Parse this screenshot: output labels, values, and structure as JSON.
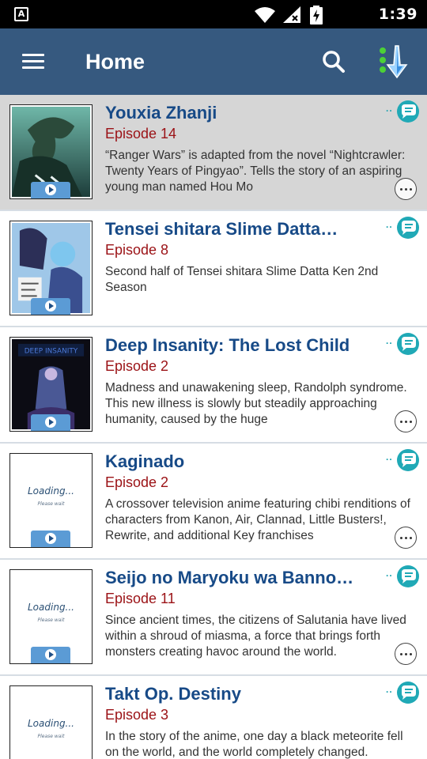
{
  "status_bar": {
    "badge": "A",
    "time": "1:39"
  },
  "app_bar": {
    "title": "Home"
  },
  "items": [
    {
      "title": "Youxia Zhanji",
      "episode": "Episode 14",
      "description": "“Ranger Wars” is adapted from the novel “Nightcrawler: Twenty Years of Pingyao”. Tells the story of an aspiring young man named Hou Mo",
      "thumb": "art-1",
      "loading": false
    },
    {
      "title": "Tensei shitara Slime Datta…",
      "episode": "Episode 8",
      "description": "Second half of Tensei shitara Slime Datta Ken 2nd Season",
      "thumb": "art-2",
      "loading": false
    },
    {
      "title": "Deep Insanity: The Lost Child",
      "episode": "Episode 2",
      "description": "Madness and unawakening sleep, Randolph syndrome. This new illness is slowly but steadily approaching humanity, caused by the huge",
      "thumb": "art-3",
      "loading": false
    },
    {
      "title": "Kaginado",
      "episode": "Episode 2",
      "description": "A crossover television anime featuring chibi renditions of characters from Kanon, Air, Clannad, Little Busters!, Rewrite, and additional Key franchises",
      "thumb": "loading",
      "loading": true,
      "loading_text": "Loading...",
      "wait_text": "Please wait"
    },
    {
      "title": "Seijo no Maryoku wa Banno…",
      "episode": "Episode 11",
      "description": "Since ancient times, the citizens of Salutania have lived within a shroud of miasma, a force that brings forth monsters creating havoc around the world.",
      "thumb": "loading",
      "loading": true,
      "loading_text": "Loading...",
      "wait_text": "Please wait"
    },
    {
      "title": "Takt Op. Destiny",
      "episode": "Episode 3",
      "description": "In the story of the anime, one day a black meteorite fell on the world, and the world completely changed.",
      "thumb": "loading",
      "loading": true,
      "loading_text": "Loading...",
      "wait_text": "Please wait"
    }
  ],
  "colors": {
    "app_bar": "#36597f",
    "title": "#174a87",
    "episode": "#9b1216",
    "accent": "#20a9b6",
    "selected_row": "#d6d6d6"
  }
}
